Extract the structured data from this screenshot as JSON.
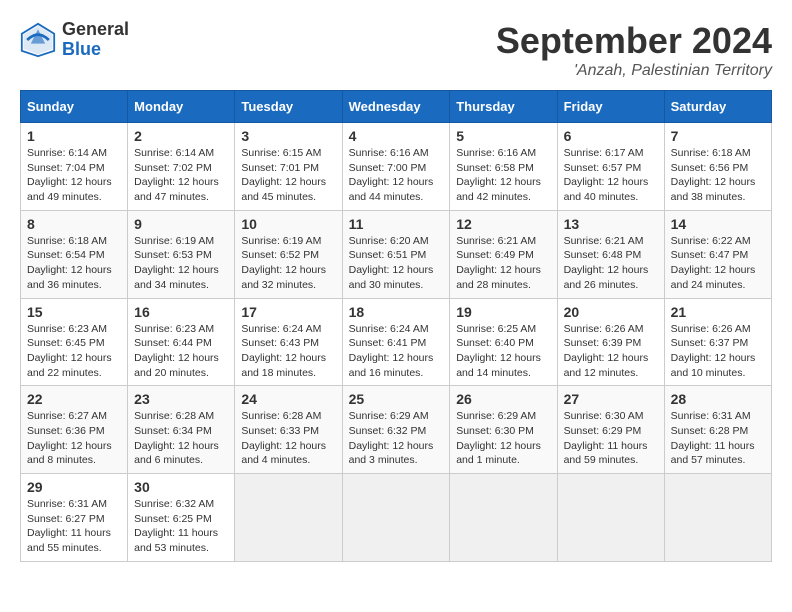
{
  "header": {
    "logo_general": "General",
    "logo_blue": "Blue",
    "month_title": "September 2024",
    "location": "'Anzah, Palestinian Territory"
  },
  "weekdays": [
    "Sunday",
    "Monday",
    "Tuesday",
    "Wednesday",
    "Thursday",
    "Friday",
    "Saturday"
  ],
  "weeks": [
    [
      {
        "day": "1",
        "sunrise": "Sunrise: 6:14 AM",
        "sunset": "Sunset: 7:04 PM",
        "daylight": "Daylight: 12 hours and 49 minutes."
      },
      {
        "day": "2",
        "sunrise": "Sunrise: 6:14 AM",
        "sunset": "Sunset: 7:02 PM",
        "daylight": "Daylight: 12 hours and 47 minutes."
      },
      {
        "day": "3",
        "sunrise": "Sunrise: 6:15 AM",
        "sunset": "Sunset: 7:01 PM",
        "daylight": "Daylight: 12 hours and 45 minutes."
      },
      {
        "day": "4",
        "sunrise": "Sunrise: 6:16 AM",
        "sunset": "Sunset: 7:00 PM",
        "daylight": "Daylight: 12 hours and 44 minutes."
      },
      {
        "day": "5",
        "sunrise": "Sunrise: 6:16 AM",
        "sunset": "Sunset: 6:58 PM",
        "daylight": "Daylight: 12 hours and 42 minutes."
      },
      {
        "day": "6",
        "sunrise": "Sunrise: 6:17 AM",
        "sunset": "Sunset: 6:57 PM",
        "daylight": "Daylight: 12 hours and 40 minutes."
      },
      {
        "day": "7",
        "sunrise": "Sunrise: 6:18 AM",
        "sunset": "Sunset: 6:56 PM",
        "daylight": "Daylight: 12 hours and 38 minutes."
      }
    ],
    [
      {
        "day": "8",
        "sunrise": "Sunrise: 6:18 AM",
        "sunset": "Sunset: 6:54 PM",
        "daylight": "Daylight: 12 hours and 36 minutes."
      },
      {
        "day": "9",
        "sunrise": "Sunrise: 6:19 AM",
        "sunset": "Sunset: 6:53 PM",
        "daylight": "Daylight: 12 hours and 34 minutes."
      },
      {
        "day": "10",
        "sunrise": "Sunrise: 6:19 AM",
        "sunset": "Sunset: 6:52 PM",
        "daylight": "Daylight: 12 hours and 32 minutes."
      },
      {
        "day": "11",
        "sunrise": "Sunrise: 6:20 AM",
        "sunset": "Sunset: 6:51 PM",
        "daylight": "Daylight: 12 hours and 30 minutes."
      },
      {
        "day": "12",
        "sunrise": "Sunrise: 6:21 AM",
        "sunset": "Sunset: 6:49 PM",
        "daylight": "Daylight: 12 hours and 28 minutes."
      },
      {
        "day": "13",
        "sunrise": "Sunrise: 6:21 AM",
        "sunset": "Sunset: 6:48 PM",
        "daylight": "Daylight: 12 hours and 26 minutes."
      },
      {
        "day": "14",
        "sunrise": "Sunrise: 6:22 AM",
        "sunset": "Sunset: 6:47 PM",
        "daylight": "Daylight: 12 hours and 24 minutes."
      }
    ],
    [
      {
        "day": "15",
        "sunrise": "Sunrise: 6:23 AM",
        "sunset": "Sunset: 6:45 PM",
        "daylight": "Daylight: 12 hours and 22 minutes."
      },
      {
        "day": "16",
        "sunrise": "Sunrise: 6:23 AM",
        "sunset": "Sunset: 6:44 PM",
        "daylight": "Daylight: 12 hours and 20 minutes."
      },
      {
        "day": "17",
        "sunrise": "Sunrise: 6:24 AM",
        "sunset": "Sunset: 6:43 PM",
        "daylight": "Daylight: 12 hours and 18 minutes."
      },
      {
        "day": "18",
        "sunrise": "Sunrise: 6:24 AM",
        "sunset": "Sunset: 6:41 PM",
        "daylight": "Daylight: 12 hours and 16 minutes."
      },
      {
        "day": "19",
        "sunrise": "Sunrise: 6:25 AM",
        "sunset": "Sunset: 6:40 PM",
        "daylight": "Daylight: 12 hours and 14 minutes."
      },
      {
        "day": "20",
        "sunrise": "Sunrise: 6:26 AM",
        "sunset": "Sunset: 6:39 PM",
        "daylight": "Daylight: 12 hours and 12 minutes."
      },
      {
        "day": "21",
        "sunrise": "Sunrise: 6:26 AM",
        "sunset": "Sunset: 6:37 PM",
        "daylight": "Daylight: 12 hours and 10 minutes."
      }
    ],
    [
      {
        "day": "22",
        "sunrise": "Sunrise: 6:27 AM",
        "sunset": "Sunset: 6:36 PM",
        "daylight": "Daylight: 12 hours and 8 minutes."
      },
      {
        "day": "23",
        "sunrise": "Sunrise: 6:28 AM",
        "sunset": "Sunset: 6:34 PM",
        "daylight": "Daylight: 12 hours and 6 minutes."
      },
      {
        "day": "24",
        "sunrise": "Sunrise: 6:28 AM",
        "sunset": "Sunset: 6:33 PM",
        "daylight": "Daylight: 12 hours and 4 minutes."
      },
      {
        "day": "25",
        "sunrise": "Sunrise: 6:29 AM",
        "sunset": "Sunset: 6:32 PM",
        "daylight": "Daylight: 12 hours and 3 minutes."
      },
      {
        "day": "26",
        "sunrise": "Sunrise: 6:29 AM",
        "sunset": "Sunset: 6:30 PM",
        "daylight": "Daylight: 12 hours and 1 minute."
      },
      {
        "day": "27",
        "sunrise": "Sunrise: 6:30 AM",
        "sunset": "Sunset: 6:29 PM",
        "daylight": "Daylight: 11 hours and 59 minutes."
      },
      {
        "day": "28",
        "sunrise": "Sunrise: 6:31 AM",
        "sunset": "Sunset: 6:28 PM",
        "daylight": "Daylight: 11 hours and 57 minutes."
      }
    ],
    [
      {
        "day": "29",
        "sunrise": "Sunrise: 6:31 AM",
        "sunset": "Sunset: 6:27 PM",
        "daylight": "Daylight: 11 hours and 55 minutes."
      },
      {
        "day": "30",
        "sunrise": "Sunrise: 6:32 AM",
        "sunset": "Sunset: 6:25 PM",
        "daylight": "Daylight: 11 hours and 53 minutes."
      },
      null,
      null,
      null,
      null,
      null
    ]
  ]
}
